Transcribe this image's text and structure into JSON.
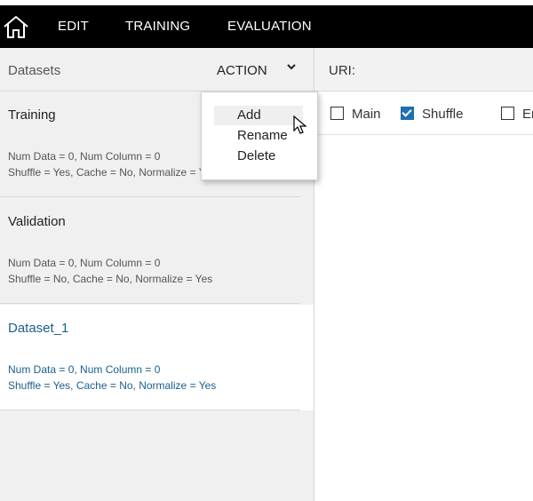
{
  "nav": {
    "home_icon": "home-icon",
    "items": [
      "EDIT",
      "TRAINING",
      "EVALUATION"
    ]
  },
  "sidebar": {
    "title": "Datasets",
    "action_label": "ACTION",
    "datasets": [
      {
        "name": "Training",
        "line1": "Num Data = 0, Num Column = 0",
        "line2": "Shuffle = Yes, Cache = No, Normalize = Yes"
      },
      {
        "name": "Validation",
        "line1": "Num Data = 0, Num Column = 0",
        "line2": "Shuffle = No, Cache = No, Normalize = Yes"
      },
      {
        "name": "Dataset_1",
        "line1": "Num Data = 0, Num Column = 0",
        "line2": "Shuffle = Yes, Cache = No, Normalize = Yes"
      }
    ]
  },
  "action_menu": {
    "items": [
      "Add",
      "Rename",
      "Delete"
    ],
    "hovered": "Add"
  },
  "main": {
    "uri_label": "URI:",
    "uri_value": "",
    "options": [
      {
        "label": "Main",
        "checked": false
      },
      {
        "label": "Shuffle",
        "checked": true
      },
      {
        "label": "En",
        "checked": false
      }
    ]
  },
  "colors": {
    "topbar": "#000000",
    "selected_text": "#1a5f8c",
    "checkbox_accent": "#1e6fb3"
  }
}
